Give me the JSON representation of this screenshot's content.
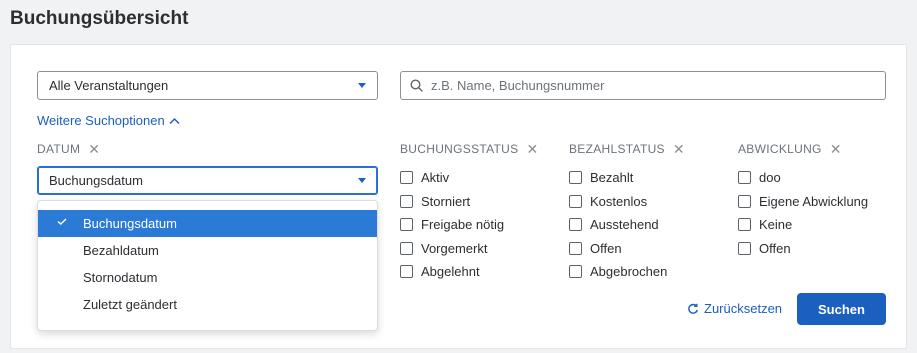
{
  "page": {
    "title": "Buchungsübersicht"
  },
  "filters": {
    "event_select": {
      "value": "Alle Veranstaltungen"
    },
    "search": {
      "placeholder": "z.B. Name, Buchungsnummer",
      "value": ""
    },
    "more_options_label": "Weitere Suchoptionen",
    "date": {
      "heading": "DATUM",
      "selected": "Buchungsdatum",
      "options": [
        "Buchungsdatum",
        "Bezahldatum",
        "Stornodatum",
        "Zuletzt geändert"
      ],
      "selected_index": 0
    },
    "booking_status": {
      "heading": "BUCHUNGSSTATUS",
      "items": [
        "Aktiv",
        "Storniert",
        "Freigabe nötig",
        "Vorgemerkt",
        "Abgelehnt"
      ]
    },
    "payment_status": {
      "heading": "BEZAHLSTATUS",
      "items": [
        "Bezahlt",
        "Kostenlos",
        "Ausstehend",
        "Offen",
        "Abgebrochen"
      ]
    },
    "processing": {
      "heading": "ABWICKLUNG",
      "items": [
        "doo",
        "Eigene Abwicklung",
        "Keine",
        "Offen"
      ]
    }
  },
  "actions": {
    "reset_label": "Zurücksetzen",
    "search_label": "Suchen"
  },
  "colors": {
    "accent": "#1b5fbf",
    "selected_option_bg": "#2a7ad6",
    "page_bg": "#f1f2f4"
  },
  "icons": {
    "dropdown": "caret-down-icon",
    "search": "search-icon",
    "expand": "chevron-up-icon",
    "clear": "close-icon",
    "check": "check-icon",
    "reset": "refresh-icon"
  }
}
